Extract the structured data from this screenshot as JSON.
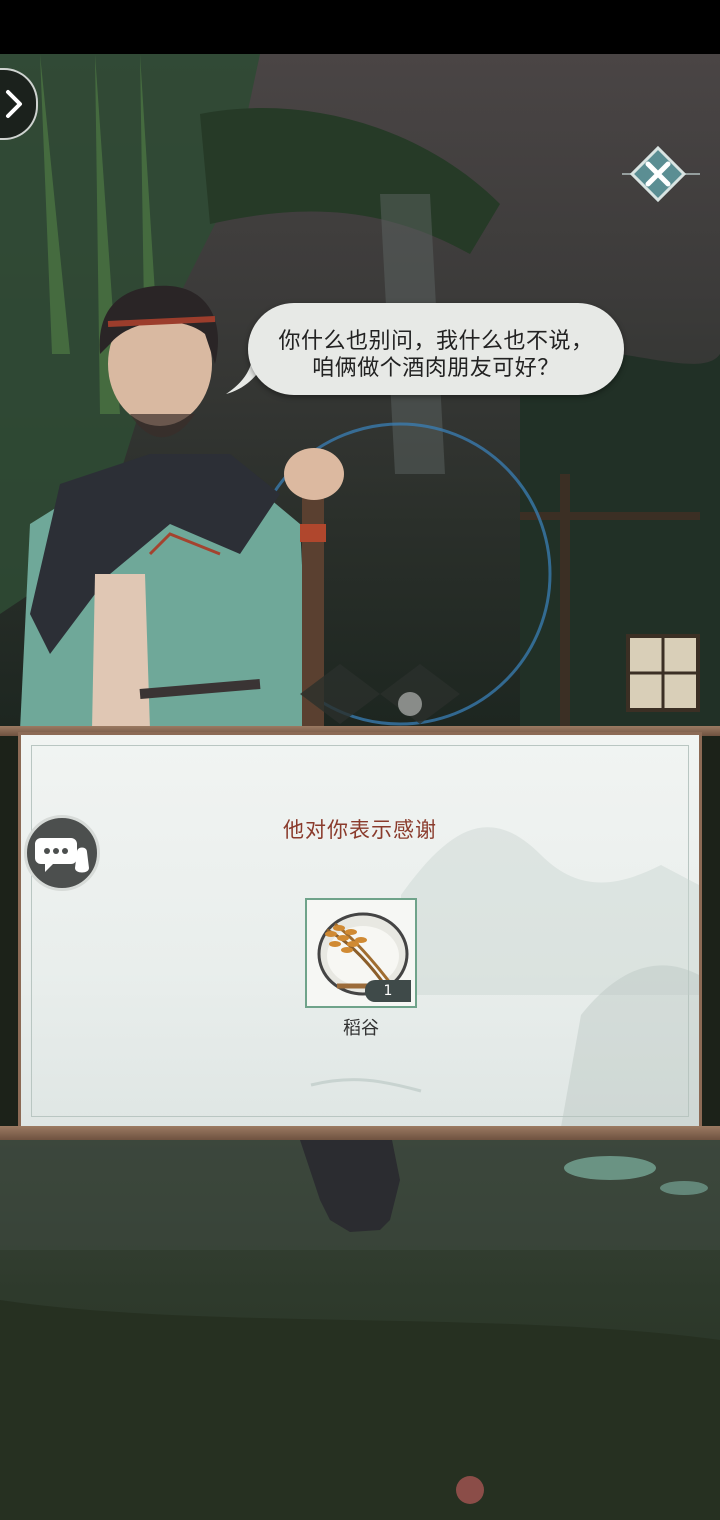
{
  "dialogue": {
    "line1": "你什么也别问，我什么也不说，",
    "line2": "咱俩做个酒肉朋友可好？"
  },
  "reward": {
    "title": "他对你表示感谢",
    "item_name": "稻谷",
    "item_count": "1"
  },
  "icons": {
    "back": "chevron-right-icon",
    "close": "close-icon",
    "chat": "chat-bubble-icon"
  },
  "colors": {
    "title_text": "#8a3b2c",
    "slot_border": "#6fa38a",
    "frame": "#8c6a55"
  }
}
